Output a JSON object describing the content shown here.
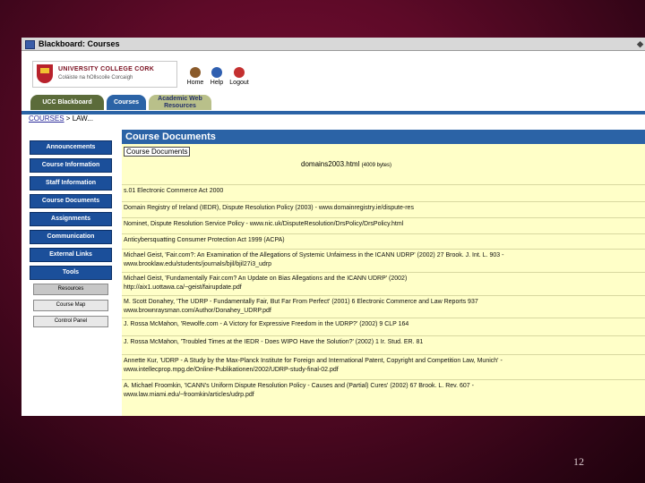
{
  "window": {
    "title": "Blackboard: Courses"
  },
  "header": {
    "logo_line1": "UNIVERSITY COLLEGE CORK",
    "logo_line2": "Coláiste na hOllscoile Corcaigh",
    "home_label": "Home",
    "help_label": "Help",
    "logout_label": "Logout"
  },
  "tabs": [
    {
      "label": "UCC Blackboard"
    },
    {
      "label": "Courses"
    },
    {
      "label": "Academic Web Resources"
    }
  ],
  "breadcrumb": {
    "link": "COURSES",
    "current": "> LAW..."
  },
  "sidebar": {
    "nav": [
      "Announcements",
      "Course Information",
      "Staff Information",
      "Course Documents",
      "Assignments",
      "Communication",
      "External Links",
      "Tools"
    ],
    "sub": [
      "Resources",
      "Course Map",
      "Control Panel"
    ]
  },
  "content": {
    "title": "Course Documents",
    "crumb": "Course Documents",
    "file_name": "domains2003.html",
    "file_size": "(4009 bytes)",
    "items": [
      "s.01 Electronic Commerce Act 2000",
      "Domain Registry of Ireland (IEDR), Dispute Resolution Policy (2003) - www.domainregistry.ie/dispute-res",
      "Nominet, Dispute Resolution Service Policy - www.nic.uk/DisputeResolution/DrsPolicy/DrsPolicy.html",
      "Anticybersquatting Consumer Protection Act 1999 (ACPA)",
      "Michael Geist, 'Fair.com?: An Examination of the Allegations of Systemic Unfairness in the ICANN UDRP' (2002) 27 Brook. J. Int. L. 903 -\nwww.brooklaw.edu/students/journals/bjil/bjil27i3_udrp",
      "Michael Geist, 'Fundamentally Fair.com? An Update on Bias Allegations and the ICANN UDRP' (2002)\nhttp://aix1.uottawa.ca/~geist/fairupdate.pdf",
      "M. Scott Donahey, 'The UDRP - Fundamentally Fair, But Far From Perfect' (2001) 6 Electronic Commerce and Law Reports 937\nwww.brownraysman.com/Author/Donahey_UDRP.pdf",
      "J. Rossa McMahon, 'Rewolfe.com - A Victory for Expressive Freedom in the UDRP?' (2002) 9 CLP 164",
      "J. Rossa McMahon, 'Troubled Times at the IEDR - Does WIPO Have the Solution?' (2002) 1 Ir. Stud. ER. 81",
      "Annette Kur, 'UDRP - A Study by the Max-Planck Institute for Foreign and International Patent, Copyright and Competition Law, Munich' -\nwww.intellecprop.mpg.de/Online-Publikationen/2002/UDRP-study-final-02.pdf",
      "A. Michael Froomkin, 'ICANN's Uniform Dispute Resolution Policy - Causes and (Partial) Cures' (2002) 67 Brook. L. Rev. 607 -\nwww.law.miami.edu/~froomkin/articles/udrp.pdf"
    ]
  },
  "page_number": "12"
}
